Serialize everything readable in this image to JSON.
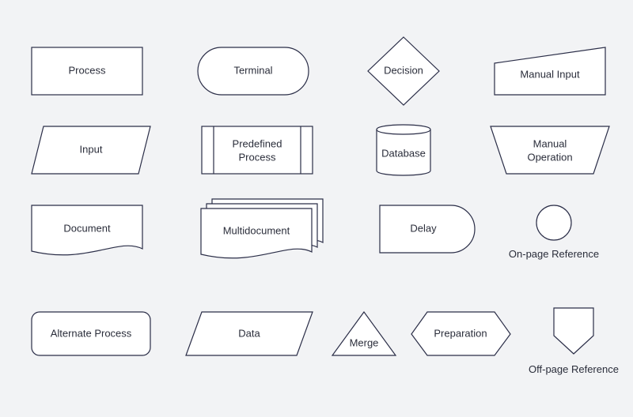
{
  "shapes": {
    "process": "Process",
    "terminal": "Terminal",
    "decision": "Decision",
    "manual_input": "Manual Input",
    "input": "Input",
    "predefined_process_l1": "Predefined",
    "predefined_process_l2": "Process",
    "database": "Database",
    "manual_operation_l1": "Manual",
    "manual_operation_l2": "Operation",
    "document": "Document",
    "multidocument": "Multidocument",
    "delay": "Delay",
    "on_page_reference": "On-page Reference",
    "alternate_process": "Alternate Process",
    "data": "Data",
    "merge": "Merge",
    "preparation": "Preparation",
    "off_page_reference": "Off-page Reference"
  },
  "style": {
    "stroke": "#2a2d47",
    "fill": "#ffffff",
    "bg": "#f2f3f5"
  }
}
